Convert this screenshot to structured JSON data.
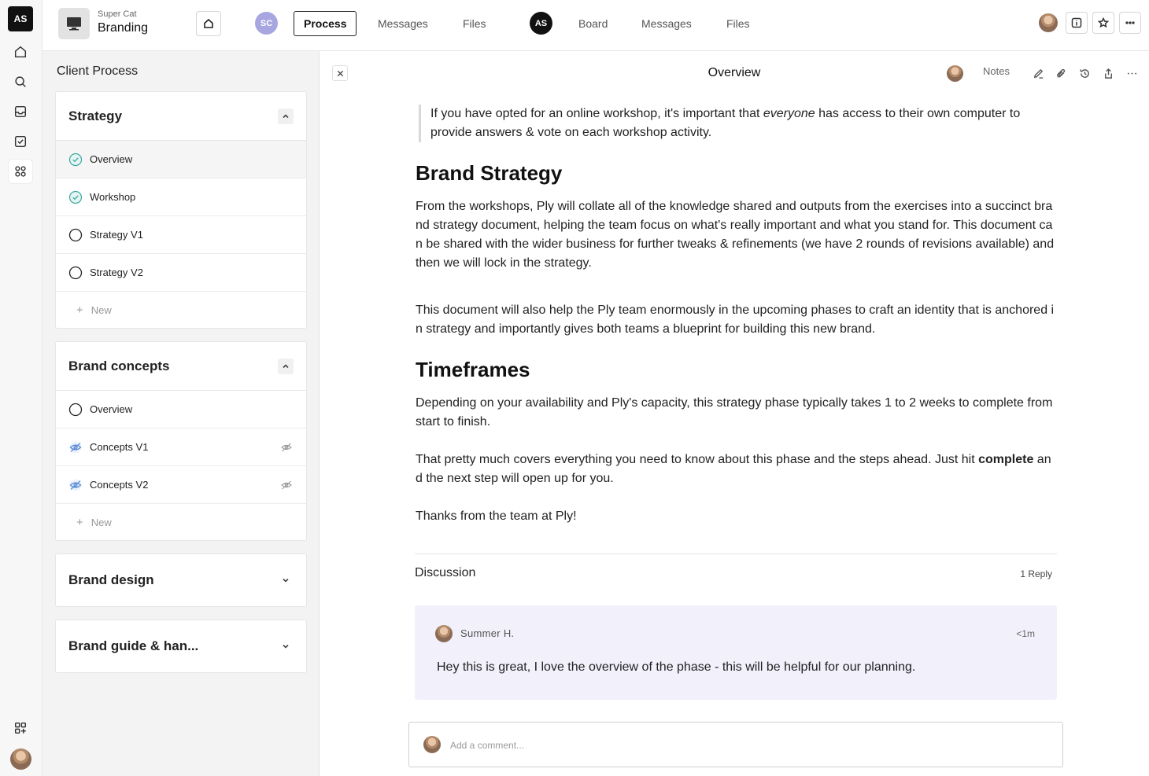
{
  "rail": {
    "workspace": "AS",
    "icons": [
      "home-icon",
      "search-icon",
      "inbox-icon",
      "tasks-icon",
      "apps-icon",
      "add-app-icon"
    ]
  },
  "topbar": {
    "client": "Super Cat",
    "project": "Branding",
    "client_badge": "SC",
    "client_tabs": [
      "Process",
      "Messages",
      "Files"
    ],
    "agency_badge": "AS",
    "agency_tabs": [
      "Board",
      "Messages",
      "Files"
    ]
  },
  "sidebar": {
    "title": "Client Process",
    "sections": [
      {
        "title": "Strategy",
        "expanded": true,
        "items": [
          {
            "label": "Overview",
            "status": "done"
          },
          {
            "label": "Workshop",
            "status": "done"
          },
          {
            "label": "Strategy V1",
            "status": "open"
          },
          {
            "label": "Strategy V2",
            "status": "open"
          }
        ],
        "new_label": "New"
      },
      {
        "title": "Brand concepts",
        "expanded": true,
        "items": [
          {
            "label": "Overview",
            "status": "open"
          },
          {
            "label": "Concepts V1",
            "status": "hidden"
          },
          {
            "label": "Concepts V2",
            "status": "hidden"
          }
        ],
        "new_label": "New"
      },
      {
        "title": "Brand design",
        "expanded": false
      },
      {
        "title": "Brand guide & han...",
        "expanded": false
      }
    ]
  },
  "main": {
    "title": "Overview",
    "notes_label": "Notes",
    "content": {
      "quote_pre": "If you have opted for an online workshop, it's important that ",
      "quote_em": "everyone",
      "quote_post": " has access to their own computer to provide answers & vote on each workshop activity.",
      "h_strategy": "Brand Strategy",
      "p1": "From the workshops, Ply will collate all of the knowledge shared and outputs from the exercises into a succinct brand strategy document, helping the team focus on what's really important and what you stand for. This document can be shared with the wider business for further tweaks & refinements (we have 2 rounds of revisions available) and then we will lock in the strategy.",
      "p2": "This document will also help the Ply team enormously in the upcoming phases to craft an identity that is anchored in strategy and importantly gives both teams a blueprint for building this new brand.",
      "h_time": "Timeframes",
      "p3": "Depending on your availability and Ply's capacity, this strategy phase typically takes 1 to 2 weeks to complete from start to finish.",
      "p4_pre": "That pretty much covers everything you need to know about this phase and the steps ahead. Just hit ",
      "p4_bold": "complete",
      "p4_post": " and the next step will open up for you.",
      "p5": "Thanks from the team at Ply!"
    },
    "discussion": {
      "title": "Discussion",
      "count": "1 Reply",
      "comment": {
        "author": "Summer H.",
        "time": "<1m",
        "text": "Hey this is great, I love the overview of the phase - this will be helpful for our planning."
      },
      "placeholder": "Add a comment..."
    }
  },
  "colors": {
    "done": "#3aa99f",
    "hidden": "#5b8bd6",
    "comment_bg": "#f1f0fb",
    "client_badge": "#a8a6e0"
  }
}
